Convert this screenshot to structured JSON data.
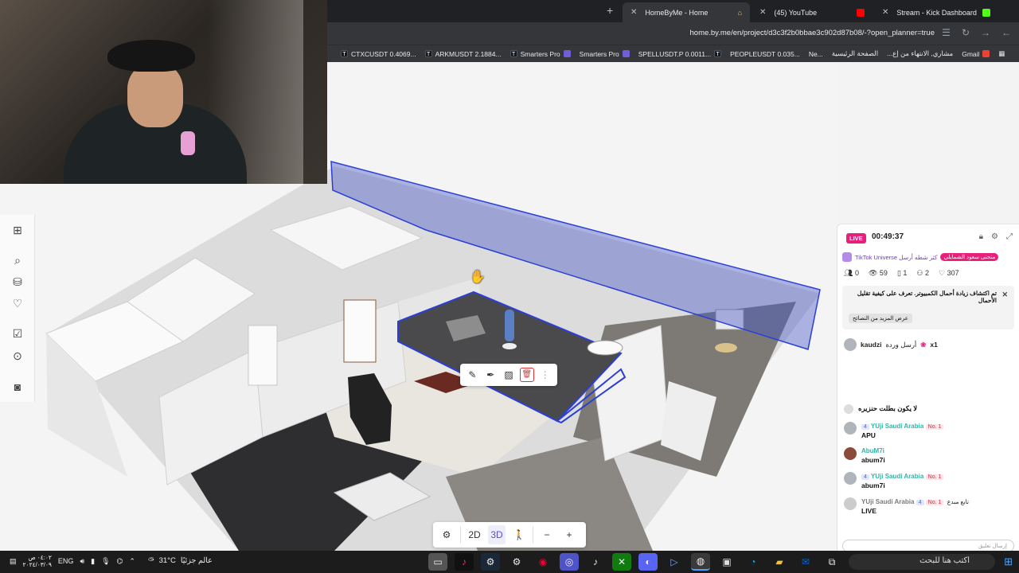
{
  "browser": {
    "tabs": [
      {
        "label": "HomeByMe - Home",
        "active": true
      },
      {
        "label": "(45) YouTube",
        "active": false
      },
      {
        "label": "Stream - Kick Dashboard",
        "active": false
      }
    ],
    "new_tab": "+",
    "url": "home.by.me/en/project/d3c3f2b0bbae3c902d87b08/-?open_planner=true",
    "bookmarks": [
      "CTXCUSDT 0.4069...",
      "ARKMUSDT 2.1884...",
      "Smarters Pro",
      "Smarters Pro",
      "SPELLUSDT.P 0.0011...",
      "PEOPLEUSDT 0.035...",
      "Ne...",
      "الصفحة الرئيسية",
      "...مشاري, الانتهاء من إع",
      "Gmail"
    ]
  },
  "planner": {
    "left_tools": [
      "floorplan-icon",
      "search-icon",
      "furniture-icon",
      "favorite-icon",
      "checklist-icon",
      "inspect-icon",
      "camera-icon"
    ],
    "context_tools": [
      "pencil-icon",
      "eyedropper-icon",
      "material-icon",
      "trash-icon"
    ],
    "bottom": {
      "settings": "⚙",
      "view2d": "2D",
      "view3d": "3D",
      "walk": "🚶",
      "zoom_out": "−",
      "zoom_in": "+"
    }
  },
  "chat": {
    "live": "LIVE",
    "timer": "00:49:37",
    "banner_text": "TikTok Universe كثر شطه أرسل",
    "banner_tag": "منحنى سعود الشمايلي",
    "stats": {
      "followers": "0",
      "views": "59",
      "clips": "1",
      "users": "2",
      "likes": "307"
    },
    "notice_text": "تم اكتشاف زيادة أحمال الكمبيوتر. تعرف على كيفية تقليل الأحمال",
    "notice_button": "عرض المزيد من النصائح",
    "gift_user": "kaudzi",
    "gift_text": "أرسل وردة",
    "gift_count": "x1",
    "messages": [
      {
        "user": "",
        "text": "لا يكون بطلت حنزيره",
        "badge": "",
        "rank": ""
      },
      {
        "user": "YUji Saudi Arabia",
        "text": "APU",
        "badge": "4",
        "rank": "No. 1"
      },
      {
        "user": "AbuM7i",
        "text": "abum7i",
        "badge": "",
        "rank": ""
      },
      {
        "user": "YUji Saudi Arabia",
        "text": "abum7i",
        "badge": "4",
        "rank": "No. 1"
      },
      {
        "user": "YUji Saudi Arabia",
        "text": "LIVE",
        "badge": "4",
        "rank": "No. 1",
        "suffix": "تابع مبدع"
      }
    ],
    "input_placeholder": "إرسال تعليق"
  },
  "taskbar": {
    "time": "٠٤:٠٢ ص",
    "date": "٢٠٢٤/٠٣/٠٩",
    "lang": "ENG",
    "weather_temp": "31°C",
    "weather_label": "عالم جزئيًا",
    "search_placeholder": "اكتب هنا للبحث"
  }
}
